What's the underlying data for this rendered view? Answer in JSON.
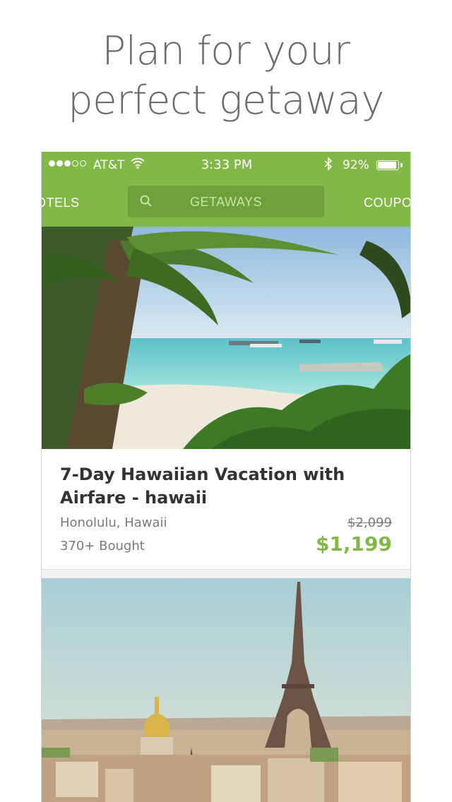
{
  "headline": {
    "line1": "Plan for your",
    "line2": "perfect getaway"
  },
  "status_bar": {
    "carrier": "AT&T",
    "time": "3:33 PM",
    "battery": "92%",
    "battery_level": 0.92
  },
  "nav": {
    "left_tab": "OTELS",
    "search_label": "GETAWAYS",
    "right_tab": "COUPO"
  },
  "deals": [
    {
      "title": "7-Day Hawaiian Vacation with Airfare - hawaii",
      "location": "Honolulu, Hawaii",
      "bought": "370+ Bought",
      "original_price": "$2,099",
      "price": "$1,199"
    }
  ],
  "colors": {
    "brand_green": "#82b848",
    "search_bg": "#6fa03a",
    "text_gray": "#7a7a7a"
  },
  "icons": [
    "signal-icon",
    "wifi-icon",
    "bluetooth-icon",
    "battery-icon",
    "search-icon"
  ]
}
